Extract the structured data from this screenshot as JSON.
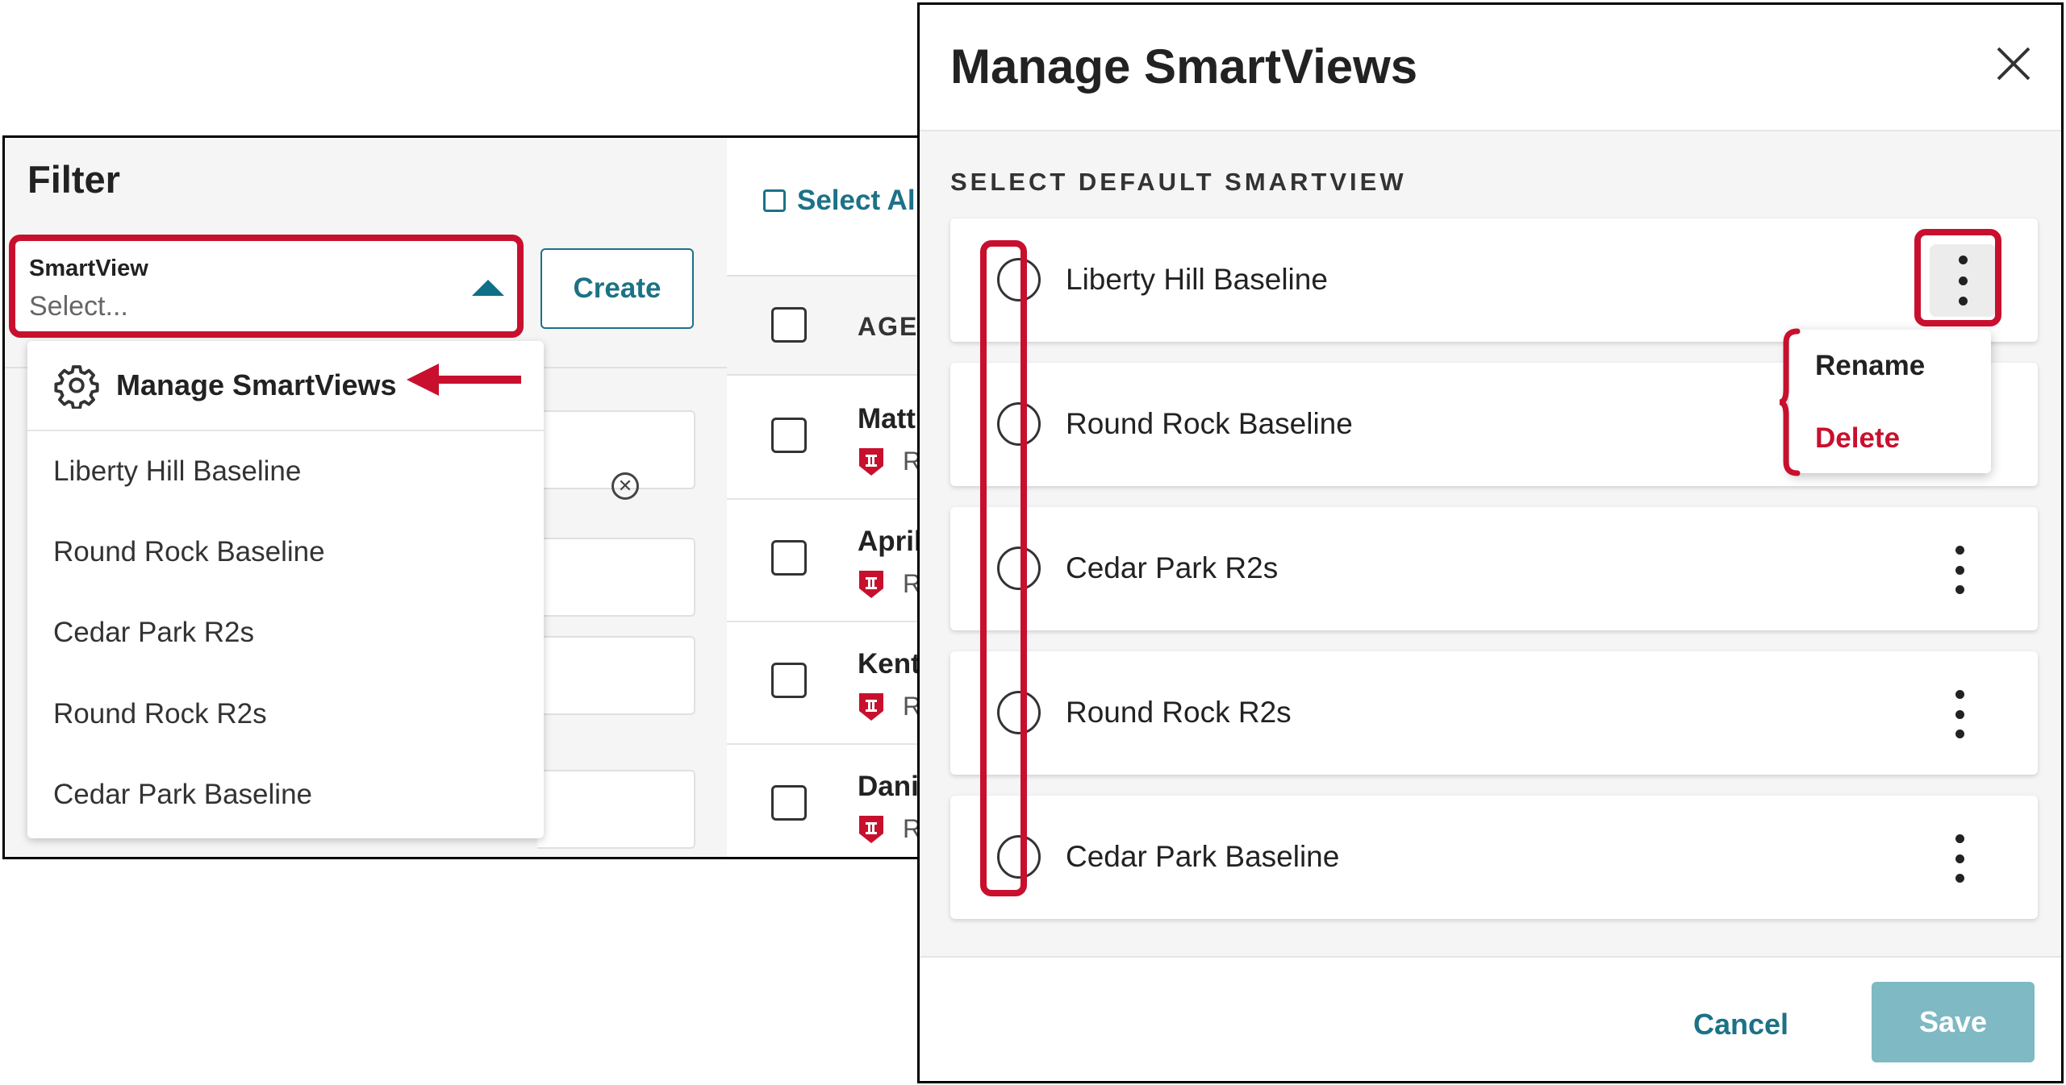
{
  "filter_panel": {
    "title": "Filter",
    "smartview_label": "SmartView",
    "smartview_placeholder": "Select...",
    "create_button": "Create",
    "dropdown": {
      "manage_label": "Manage SmartViews",
      "items": [
        "Liberty Hill Baseline",
        "Round Rock Baseline",
        "Cedar Park R2s",
        "Round Rock R2s",
        "Cedar Park Baseline"
      ]
    }
  },
  "table": {
    "select_all": "Select Al",
    "column_header": "AGEI",
    "rows": [
      {
        "name": "Matt",
        "tag": "R"
      },
      {
        "name": "April",
        "tag": "R"
      },
      {
        "name": "Kent",
        "tag": "R"
      },
      {
        "name": "Dani",
        "tag": "R"
      }
    ]
  },
  "modal": {
    "title": "Manage SmartViews",
    "section_label": "SELECT DEFAULT SMARTVIEW",
    "smartviews": [
      "Liberty Hill Baseline",
      "Round Rock Baseline",
      "Cedar Park R2s",
      "Round Rock R2s",
      "Cedar Park Baseline"
    ],
    "context_menu": {
      "rename": "Rename",
      "delete": "Delete"
    },
    "cancel_button": "Cancel",
    "save_button": "Save"
  },
  "colors": {
    "accent": "#1c7287",
    "annotation_red": "#c8102e",
    "save_disabled": "#7fb9c3",
    "brand_tag": "#c8102e"
  },
  "icons": [
    "gear-icon",
    "caret-up-icon",
    "clear-circle-icon",
    "close-icon",
    "kebab-menu-icon",
    "shield-badge-icon",
    "arrow-left-icon",
    "brace-icon"
  ]
}
